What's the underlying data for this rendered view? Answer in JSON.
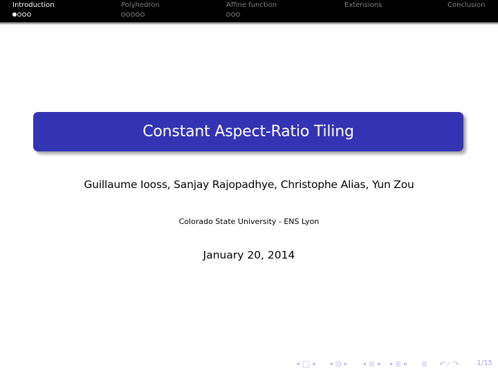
{
  "headline": {
    "sections": [
      {
        "label": "Introduction",
        "active": true,
        "subsections": 4,
        "current_subsection": 1
      },
      {
        "label": "Polyhedron",
        "active": false,
        "subsections": 5
      },
      {
        "label": "Affine function",
        "active": false,
        "subsections": 3
      },
      {
        "label": "Extensions",
        "active": false,
        "subsections": 0
      },
      {
        "label": "Conclusion",
        "active": false,
        "subsections": 0
      }
    ]
  },
  "slide": {
    "title": "Constant Aspect-Ratio Tiling",
    "authors": "Guillaume Iooss, Sanjay Rajopadhye, Christophe Alias, Yun Zou",
    "institute": "Colorado State University - ENS Lyon",
    "date": "January 20, 2014"
  },
  "navigation": {
    "icons": {
      "left_arrow": "◂",
      "right_arrow": "▸",
      "frame": "□",
      "subsection": "⧉",
      "section": "≣",
      "undo": "↶",
      "search": "⌕",
      "redo": "↷"
    },
    "page": "1/15"
  },
  "colors": {
    "title_box": "#3333b3",
    "nav_symbols": "#c2c2e8",
    "headline_bg": "#000000"
  }
}
